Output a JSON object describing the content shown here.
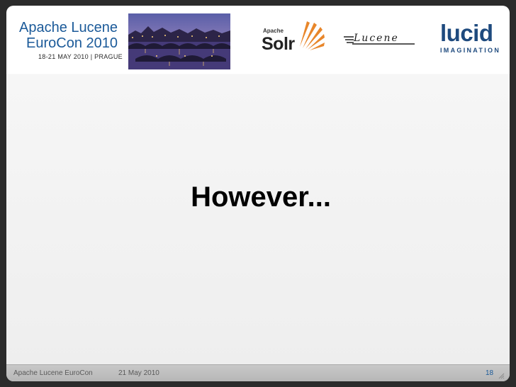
{
  "header": {
    "conference": {
      "line1": "Apache Lucene",
      "line2": "EuroCon 2010",
      "dates": "18-21 MAY 2010 | PRAGUE"
    },
    "solr_logo": {
      "apache": "Apache",
      "word": "Solr"
    },
    "lucene_logo": {
      "word": "Lucene"
    },
    "lucid_logo": {
      "word": "lucid",
      "sub": "IMAGINATION"
    }
  },
  "slide": {
    "title": "However..."
  },
  "footer": {
    "conference": "Apache Lucene EuroCon",
    "date": "21 May 2010",
    "page_number": "18"
  },
  "colors": {
    "brand_blue": "#1b5a99",
    "lucid_blue": "#1e4a7e",
    "background": "#2b2b2b"
  }
}
